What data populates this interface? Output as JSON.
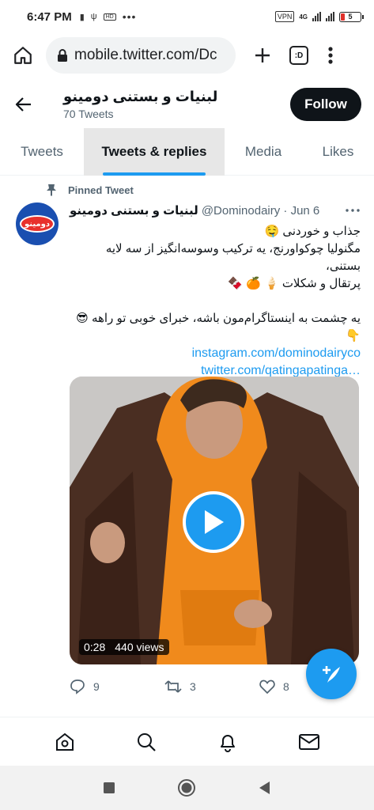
{
  "status_bar": {
    "time": "6:47 PM",
    "vpn": "VPN",
    "network": "4G",
    "battery": "5"
  },
  "browser": {
    "url": "mobile.twitter.com/Dc",
    "tabs_count": ":D"
  },
  "profile": {
    "name": "لبنیات و بستنی دومینو",
    "tweet_count": "70 Tweets",
    "follow_label": "Follow"
  },
  "tabs": [
    {
      "label": "Tweets",
      "active": false
    },
    {
      "label": "Tweets & replies",
      "active": true
    },
    {
      "label": "Media",
      "active": false
    },
    {
      "label": "Likes",
      "active": false
    }
  ],
  "tweet": {
    "pinned_label": "Pinned Tweet",
    "author_name": "لبنیات و بستنی دومینو",
    "handle_date": "@Dominodairy · Jun 6",
    "avatar_text": "دومینو",
    "lines": [
      "جذاب و خوردنی 🤤",
      "مگنولیا چوکواورنج، یه ترکیب وسوسه‌انگیز از سه لایه بستنی،",
      "پرتقال و شکلات 🍦 🍊 🍫",
      "",
      "یه چشمت به اینستاگرام‌مون باشه، خبرای خوبی تو راهه 😎",
      "👇"
    ],
    "links": [
      "instagram.com/dominodairyco",
      "twitter.com/qatingapatinga…"
    ],
    "video_duration": "0:28",
    "video_views": "440 views",
    "replies": "9",
    "retweets": "3",
    "likes": "8"
  },
  "colors": {
    "accent": "#1d9bf0",
    "follow_bg": "#0f1419",
    "jacket": "#4a2e22",
    "hoodie": "#f08a1c"
  },
  "icons": {
    "home": "home-icon",
    "search": "search-icon",
    "notifications": "bell-icon",
    "messages": "mail-icon",
    "compose": "compose-icon"
  }
}
